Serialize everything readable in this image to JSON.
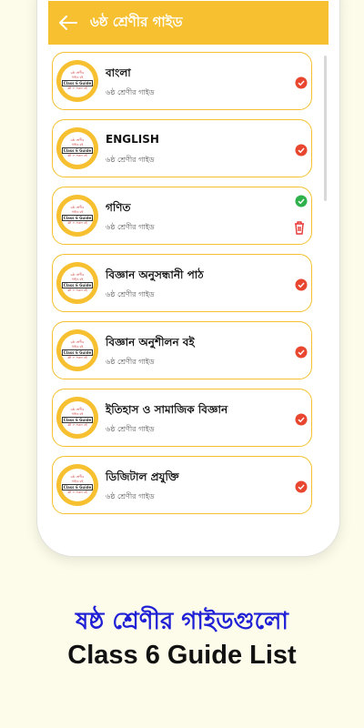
{
  "appbar": {
    "title": "৬ষ্ঠ শ্রেণীর গাইড"
  },
  "logo": {
    "line1": "৬ষ্ঠ শ্রেণীর",
    "line2": "গাইড বই",
    "line3": "Class 6 Guide",
    "line4": "ফ্রী + সকল বই"
  },
  "items": [
    {
      "title": "বাংলা",
      "subtitle": "৬ষ্ঠ শ্রেণীর গাইড",
      "status": "red"
    },
    {
      "title": "ENGLISH",
      "subtitle": "৬ষ্ঠ শ্রেণীর গাইড",
      "status": "red"
    },
    {
      "title": "গণিত",
      "subtitle": "৬ষ্ঠ শ্রেণীর গাইড",
      "status": "green"
    },
    {
      "title": "বিজ্ঞান অনুসন্ধানী পাঠ",
      "subtitle": "৬ষ্ঠ শ্রেণীর গাইড",
      "status": "red"
    },
    {
      "title": "বিজ্ঞান অনুশীলন বই",
      "subtitle": "৬ষ্ঠ শ্রেণীর গাইড",
      "status": "red"
    },
    {
      "title": "ইতিহাস ও সামাজিক বিজ্ঞান",
      "subtitle": "৬ষ্ঠ শ্রেণীর গাইড",
      "status": "red"
    },
    {
      "title": "ডিজিটাল প্রযুক্তি",
      "subtitle": "৬ষ্ঠ শ্রেণীর গাইড",
      "status": "red"
    }
  ],
  "caption": {
    "bangla": "ষষ্ঠ শ্রেণীর গাইডগুলো",
    "english": "Class 6 Guide List"
  },
  "colors": {
    "accent": "#f7c030",
    "downloaded": "#2fb24c",
    "not_downloaded": "#e8462f",
    "delete": "#e53935",
    "caption_bangla": "#1f1fd6"
  }
}
